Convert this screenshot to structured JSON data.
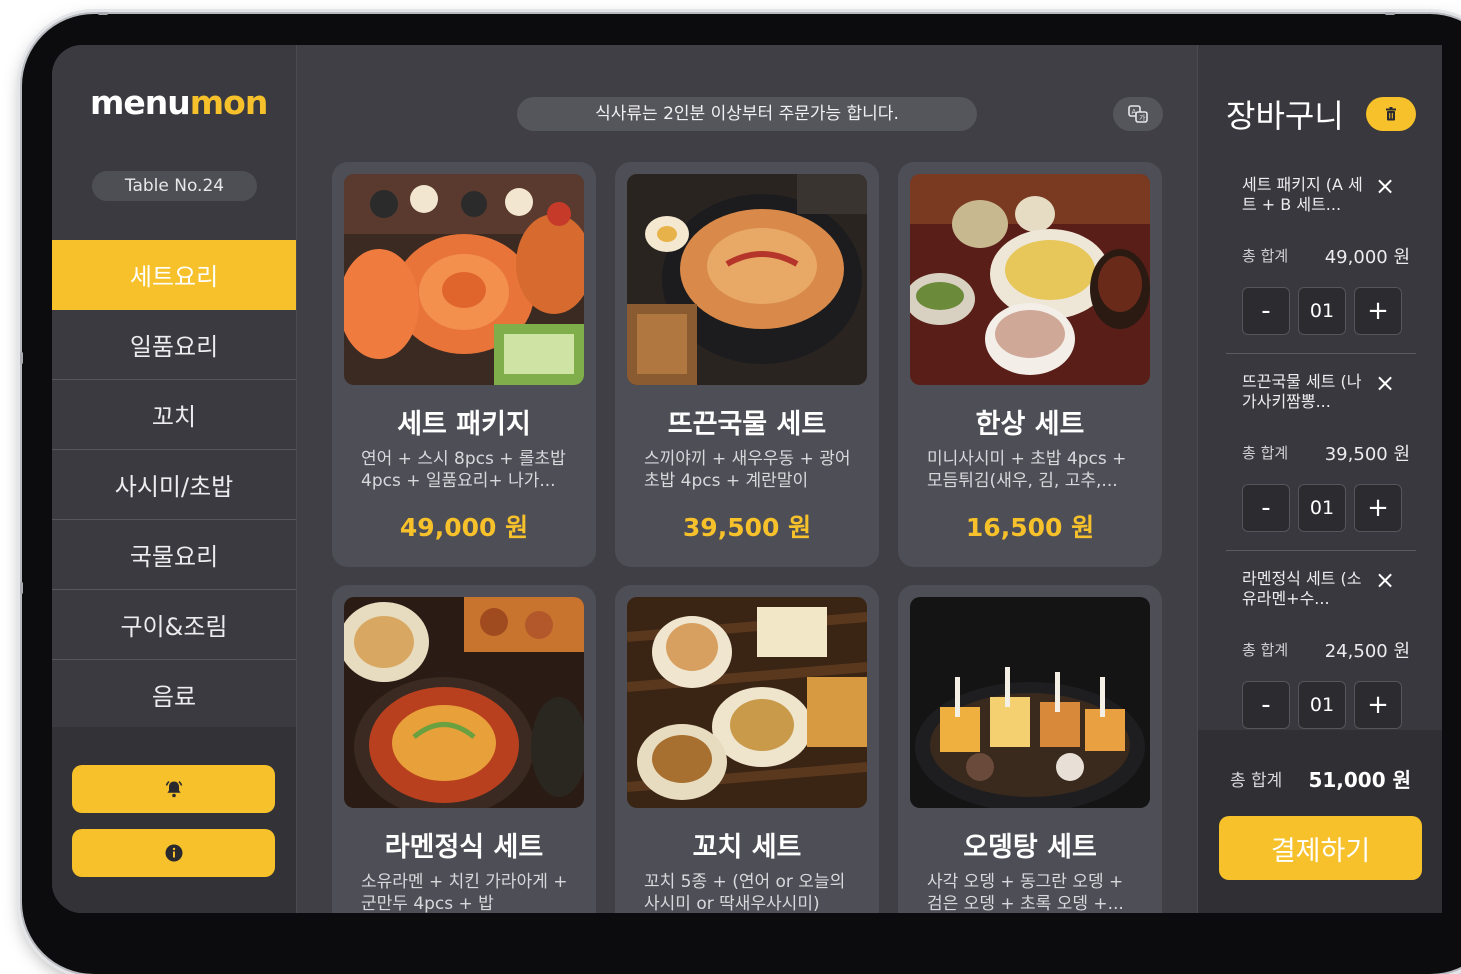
{
  "app": {
    "logo_prefix": "menu",
    "logo_accent": "mon"
  },
  "sidebar": {
    "table_label": "Table No.24",
    "categories": [
      {
        "label": "세트요리",
        "active": true
      },
      {
        "label": "일품요리",
        "active": false
      },
      {
        "label": "꼬치",
        "active": false
      },
      {
        "label": "사시미/초밥",
        "active": false
      },
      {
        "label": "국물요리",
        "active": false
      },
      {
        "label": "구이&조림",
        "active": false
      },
      {
        "label": "음료",
        "active": false
      }
    ],
    "bottom_buttons": [
      {
        "icon": "bell-icon"
      },
      {
        "icon": "info-icon"
      }
    ]
  },
  "header": {
    "notice": "식사류는 2인분 이상부터 주문가능 합니다.",
    "translate_icon": "translate-icon"
  },
  "menu": {
    "items": [
      {
        "title": "세트 패키지",
        "desc1": "연어 + 스시 8pcs + 롤초밥",
        "desc2": "4pcs + 일품요리+ 나가...",
        "price": "49,000 원"
      },
      {
        "title": "뜨끈국물 세트",
        "desc1": "스끼야끼 + 새우우동 + 광어",
        "desc2": "초밥 4pcs + 계란말이",
        "price": "39,500 원"
      },
      {
        "title": "한상 세트",
        "desc1": "미니사시미 + 초밥 4pcs +",
        "desc2": "모듬튀김(새우, 김, 고추,...",
        "price": "16,500 원"
      },
      {
        "title": "라멘정식 세트",
        "desc1": "소유라멘 + 치킨 가라아게 +",
        "desc2": "군만두 4pcs + 밥",
        "price": ""
      },
      {
        "title": "꼬치 세트",
        "desc1": "꼬치 5종 + (연어 or 오늘의",
        "desc2": "사시미 or 딱새우사시미)",
        "price": ""
      },
      {
        "title": "오뎅탕 세트",
        "desc1": "사각 오뎅 + 동그란 오뎅 +",
        "desc2": "검은 오뎅 + 초록 오뎅 +...",
        "price": ""
      }
    ]
  },
  "cart": {
    "title": "장바구니",
    "trash_icon": "trash-icon",
    "items": [
      {
        "name": "세트 패키지 (A 세트 + B 세트...",
        "total_label": "총 합계",
        "total": "49,000 원",
        "qty": "01",
        "minus": "-",
        "plus": "+",
        "close": "×"
      },
      {
        "name": "뜨끈국물 세트 (나가사키짬뽕...",
        "total_label": "총 합계",
        "total": "39,500 원",
        "qty": "01",
        "minus": "-",
        "plus": "+",
        "close": "×"
      },
      {
        "name": "라멘정식 세트 (소유라멘+수...",
        "total_label": "총 합계",
        "total": "24,500 원",
        "qty": "01",
        "minus": "-",
        "plus": "+",
        "close": "×"
      }
    ],
    "footer_label": "총 합계",
    "footer_total": "51,000 원",
    "pay_label": "결제하기"
  },
  "colors": {
    "accent": "#f6c12a",
    "panel": "#3f3f45",
    "card": "#4e4e56"
  }
}
